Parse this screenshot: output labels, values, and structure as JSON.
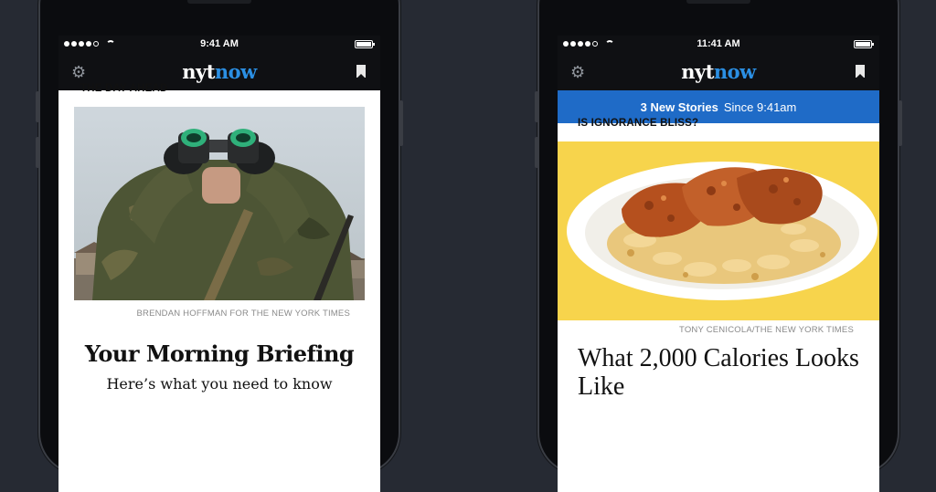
{
  "phones": [
    {
      "status": {
        "time": "9:41 AM"
      },
      "nav": {
        "logo_nyt": "nyt",
        "logo_now": "now"
      },
      "kicker": "THE DAY AHEAD",
      "credit": "BRENDAN HOFFMAN FOR THE NEW YORK TIMES",
      "headline": "Your Morning Briefing",
      "dek": "Here’s what you need to know"
    },
    {
      "status": {
        "time": "11:41 AM"
      },
      "nav": {
        "logo_nyt": "nyt",
        "logo_now": "now"
      },
      "banner": {
        "count_label": "3 New Stories",
        "since_label": "Since 9:41am"
      },
      "kicker": "IS IGNORANCE BLISS?",
      "credit": "TONY CENICOLA/THE NEW YORK TIMES",
      "headline": "What 2,000 Calories Looks Like"
    }
  ],
  "icons": {
    "settings": "gear-icon",
    "bookmark": "bookmark-icon",
    "wifi": "wifi-icon",
    "battery": "battery-icon",
    "signal": "signal-icon"
  },
  "colors": {
    "background": "#262a33",
    "nav_bar": "#0f1013",
    "logo_accent": "#2b8fe3",
    "banner": "#1f6bc7",
    "food_backdrop": "#f7d44c"
  }
}
